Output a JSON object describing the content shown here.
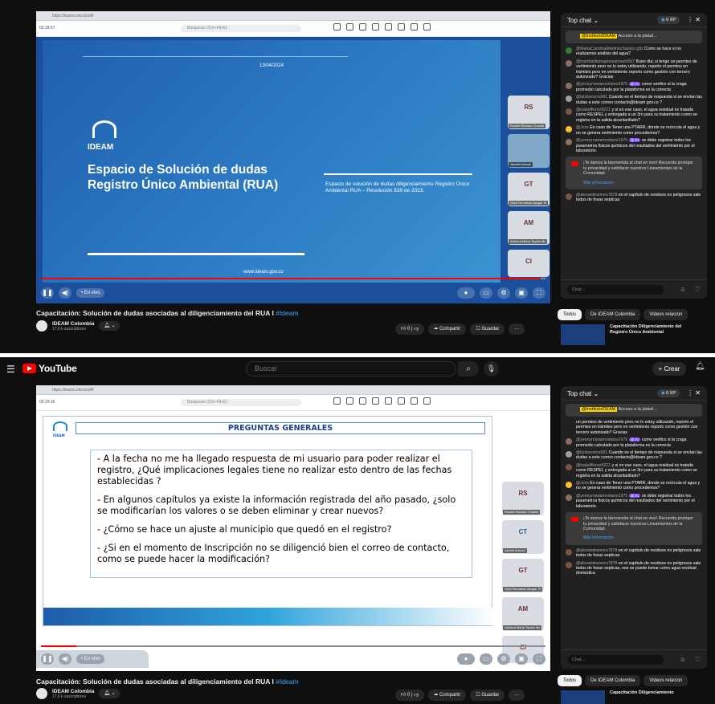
{
  "shot1": {
    "address_bar": "https://teams.microsoft/",
    "meeting_search": "Búsqueda (Ctrl+Alt+E)",
    "meeting_time": "00:28:57",
    "slide": {
      "date": "13/04/2024",
      "logo_text": "IDEAM",
      "title": "Espacio de Solución de dudas Registro Único Ambiental (RUA)",
      "subtitle": "Espacio de solución de dudas diligenciamiento Registro Único Ambiental RUA – Resolución 839 de 2023.",
      "url": "www.ideam.gov.co"
    },
    "participants": [
      {
        "initials": "RS",
        "name": "Rosdel Ricardo Chambi"
      },
      {
        "initials": "",
        "name": "Janeth Arenas"
      },
      {
        "initials": "GT",
        "name": "Gina Fernanda Vargas Te"
      },
      {
        "initials": "AM",
        "name": "Adriana María Tapias Mu"
      },
      {
        "initials": "CI",
        "name": ""
      }
    ],
    "live_label": "• En vivo",
    "video_title": "Capacitación: Solución de dudas asociadas al diligenciamiento del RUA I",
    "hashtag": "#Ideam",
    "channel": {
      "name": "IDEAM Colombia",
      "subs": "17,6 k suscriptores"
    },
    "actions": {
      "likes": "0",
      "share": "Compartir",
      "save": "Guardar"
    },
    "chat": {
      "title": "Top chat",
      "xp": "0 XP",
      "pinned_author": "@InstitutoIDEAM",
      "pinned_text": "Acceso a la plataf...",
      "messages": [
        {
          "author": "@MariaCarolinaMartinezSantos-g9z",
          "text": "Como se hace si no realizamos análisis del agua?",
          "color": "#2e7d32"
        },
        {
          "author": "@marthaliliamaponzamuelo567",
          "text": "Buen día; si tengo un permiso de vertimiento pero no lo estoy utilizando, reporto el permiso en trámites pero en vertimiento reporto como gestión con tercero autorizado? Gracias",
          "color": "#8d6e63"
        },
        {
          "author": "@yennyrnariamontano1975",
          "badge": "@ #1",
          "text": "como verifico si la craga promedio calculado por la plataforma es la correcta",
          "color": "#8d6e63"
        },
        {
          "author": "@luisbecerra991",
          "text": "Cuando es el tiempo de respuesta si se envían las dudas a este correo contacto@ideam.gov.co ?",
          "color": "#9e9e9e"
        },
        {
          "author": "@isabelflorez9221",
          "text": "y si en ese caso, el agua residual es tratada como RESPEL y entregada a un 3ro para su tratamiento como se registra en la salida alcantarillado?",
          "color": "#795548"
        },
        {
          "author": "@Jcns",
          "text": "En caso de Tener una PTARR, donde se recircula el agua y no se genera vertimiento como procedemos?",
          "color": "#fbc02d"
        },
        {
          "author": "@yennyrnariamontano1975",
          "badge": "@ #1",
          "text": "se debe registrar todos los parametros fisicos químicos del resultados del vertimiento por el laboratorio.",
          "color": "#8d6e63"
        }
      ],
      "notice": "¡Te damos la bienvenida al chat en vivo! Recuerda proteger tu privacidad y satisfacer nuestros Lineamientos de la Comunidad.",
      "notice_more": "Más información",
      "last_msg": {
        "author": "@alexandramoro7878",
        "text": "en el capítulo de residuos no peligrosos sale todos de fosas septicas",
        "color": "#795548"
      },
      "input_placeholder": "Chat..."
    },
    "tabs": [
      "Todos",
      "De IDEAM Colombia",
      "Videos relacion"
    ],
    "next_video": "Capacitación Diligenciamiento del Registro Único Ambiental"
  },
  "shot2": {
    "yt_logo": "YouTube",
    "search_placeholder": "Buscar",
    "create": "+ Crear",
    "address_bar": "https://teams.microsoft/",
    "meeting_search": "Búsqueda (Ctrl+Alt+E)",
    "meeting_time": "00:29:26",
    "page": {
      "logo_text": "IDEAM",
      "heading": "PREGUNTAS GENERALES",
      "questions": [
        "- A la fecha no me ha llegado respuesta de mi usuario para poder realizar el registro, ¿Qué implicaciones legales tiene no realizar esto dentro de las fechas establecidas ?",
        "- En algunos capítulos ya existe la información registrada del año pasado, ¿solo se modificarían los valores o se deben eliminar y crear nuevos?",
        "- ¿Cómo se hace un ajuste al municipio que quedó en el registro?",
        "- ¿Si en el momento de Inscripción no se diligenció bien el correo de contacto, como se puede hacer la modificación?"
      ]
    },
    "participants": [
      {
        "initials": "RS",
        "name": "Rosdel Ricardo Chambi"
      },
      {
        "initials": "CT",
        "name": "Janeth Arenas"
      },
      {
        "initials": "GT",
        "name": "Gina Fernanda Vargas Te"
      },
      {
        "initials": "AM",
        "name": "Adriana María Tapias Mu"
      },
      {
        "initials": "CI",
        "name": ""
      }
    ],
    "live_label": "• En vivo",
    "video_title": "Capacitación: Solución de dudas asociadas al diligenciamiento del RUA I",
    "hashtag": "#Ideam",
    "channel": {
      "name": "IDEAM Colombia",
      "subs": "17,6 k suscriptores"
    },
    "actions": {
      "likes": "0",
      "share": "Compartir",
      "save": "Guardar"
    },
    "chat": {
      "title": "Top chat",
      "xp": "0 XP",
      "pinned_author": "@InstitutoIDEAM",
      "pinned_text": "Acceso a la plataf...",
      "messages": [
        {
          "author": "",
          "text": "un permiso de vertimiento pero no lo estoy utilizando, reporto el permiso en trámites pero en vertimiento reporto como gestión con tercero autorizado? Gracias",
          "color": ""
        },
        {
          "author": "@yennyrnariamontano1975",
          "badge": "@ #1",
          "text": "como verifico si la craga promedio calculado por la plataforma es la correcta",
          "color": "#8d6e63"
        },
        {
          "author": "@luisbecerra991",
          "text": "Cuando es el tiempo de respuesta si se envían las dudas a este correo contacto@ideam.gov.co ?",
          "color": "#9e9e9e"
        },
        {
          "author": "@isabelflorez9221",
          "text": "y si en ese caso, el agua residual es tratada como RESPEL y entregada a un 3ro para su tratamiento como se registra en la salida alcantarillado?",
          "color": "#795548"
        },
        {
          "author": "@Jcns",
          "text": "En caso de Tener una PTARR, donde se recircula el agua y no se genera vertimiento como procedemos?",
          "color": "#fbc02d"
        },
        {
          "author": "@yennyrnariamontano1975",
          "badge": "@ #1",
          "text": "se debe registrar todos los parametros fisicos químicos del resultados del vertimiento por el laboratorio.",
          "color": "#8d6e63"
        }
      ],
      "notice": "¡Te damos la bienvenida al chat en vivo! Recuerda proteger tu privacidad y satisfacer nuestros Lineamientos de la Comunidad.",
      "notice_more": "Más información",
      "last_msgs": [
        {
          "author": "@alexandramoro7878",
          "text": "en el capítulo de residuos no peligrosos sale todos de fosas septicas",
          "color": "#795548"
        },
        {
          "author": "@alexandramoro7878",
          "text": "en el capítulo de residuos no peligrosos sale todos de fosas septicas, ese se puede tomar como agua residual domestica",
          "color": "#795548"
        }
      ],
      "input_placeholder": "Chat..."
    },
    "tabs": [
      "Todos",
      "De IDEAM Colombia",
      "Videos relacion"
    ],
    "next_video": "Capacitación Diligenciamiento"
  }
}
